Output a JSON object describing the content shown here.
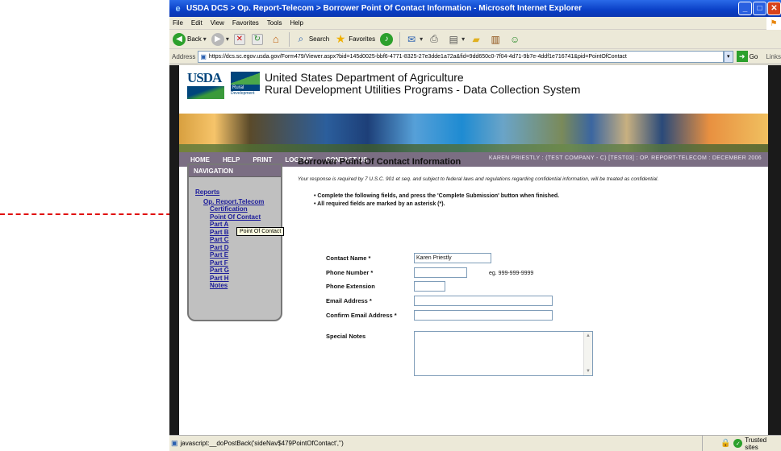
{
  "window": {
    "title": "USDA DCS > Op. Report-Telecom > Borrower Point Of Contact Information - Microsoft Internet Explorer"
  },
  "menubar": [
    "File",
    "Edit",
    "View",
    "Favorites",
    "Tools",
    "Help"
  ],
  "toolbar": {
    "back": "Back",
    "search": "Search",
    "favorites": "Favorites"
  },
  "address": {
    "label": "Address",
    "url": "https://dcs.sc.egov.usda.gov/Form479/Viewer.aspx?bid=145d0025-bbf6-4771-8325-27e3dde1a72a&fid=9dd650c0-7f04-4d71-9b7e-4ddf1e716741&pid=PointOfContact",
    "go": "Go",
    "links": "Links"
  },
  "site": {
    "org_line1": "United States Department of Agriculture",
    "org_line2": "Rural Development Utilities Programs - Data Collection System",
    "logo_text": "USDA",
    "rural_label": "Rural",
    "rural_sub": "Development"
  },
  "nav": {
    "items": [
      "HOME",
      "HELP",
      "PRINT",
      "LOGOUT",
      "CONTACT US"
    ],
    "user_info": "KAREN PRIESTLY : (TEST COMPANY - C) [TEST03] : OP. REPORT-TELECOM : DECEMBER 2006"
  },
  "sidebar": {
    "title": "NAVIGATION",
    "reports": "Reports",
    "report_name": "Op. Report.Telecom",
    "items": [
      "Certification",
      "Point Of Contact",
      "Part A",
      "Part B",
      "Part C",
      "Part D",
      "Part E",
      "Part F",
      "Part G",
      "Part H",
      "Notes"
    ],
    "tooltip": "Point Of Contact"
  },
  "main": {
    "heading": "Borrower Point Of Contact Information",
    "notice": "Your response is required by 7 U.S.C. 901 et seq. and subject to federal laws and regulations regarding confidential information, will be treated as confidential.",
    "bullets": [
      "Complete the following fields, and press the 'Complete Submission' button when finished.",
      "All required fields are marked by an asterisk (*)."
    ]
  },
  "form": {
    "contact_name_label": "Contact Name *",
    "contact_name_value": "Karen Priestly",
    "phone_label": "Phone Number *",
    "phone_value": "",
    "phone_hint": "eg. 999-999-9999",
    "ext_label": "Phone Extension",
    "ext_value": "",
    "email_label": "Email Address *",
    "email_value": "",
    "confirm_email_label": "Confirm Email Address *",
    "confirm_email_value": "",
    "notes_label": "Special Notes"
  },
  "status": {
    "text": "javascript:__doPostBack('sideNav$479PointOfContact','')",
    "zone": "Trusted sites"
  },
  "colors": {
    "nav_bg": "#7b6e83",
    "titlebar": "#0a3fc6",
    "link": "#1a1a9a",
    "annotation": "#e01010"
  }
}
